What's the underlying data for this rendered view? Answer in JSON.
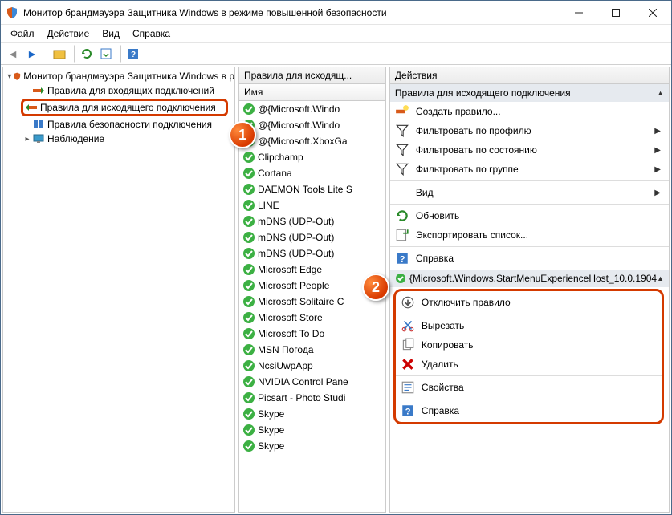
{
  "titlebar": {
    "title": "Монитор брандмауэра Защитника Windows в режиме повышенной безопасности"
  },
  "menu": {
    "file": "Файл",
    "action": "Действие",
    "view": "Вид",
    "help": "Справка"
  },
  "tree": {
    "root": "Монитор брандмауэра Защитника Windows в р",
    "inbound": "Правила для входящих подключений",
    "outbound": "Правила для исходящего подключения",
    "connsec": "Правила безопасности подключения",
    "monitoring": "Наблюдение"
  },
  "rules": {
    "panel_title": "Правила для исходящ...",
    "col_name": "Имя",
    "items": [
      "@{Microsoft.Windo",
      "@{Microsoft.Windo",
      "@{Microsoft.XboxGa",
      "Clipchamp",
      "Cortana",
      "DAEMON Tools Lite S",
      "LINE",
      "mDNS (UDP-Out)",
      "mDNS (UDP-Out)",
      "mDNS (UDP-Out)",
      "Microsoft Edge",
      "Microsoft People",
      "Microsoft Solitaire C",
      "Microsoft Store",
      "Microsoft To Do",
      "MSN Погода",
      "NcsiUwpApp",
      "NVIDIA Control Pane",
      "Picsart - Photo Studi",
      "Skype",
      "Skype",
      "Skype"
    ]
  },
  "actions": {
    "panel_title": "Действия",
    "section1_title": "Правила для исходящего подключения",
    "create_rule": "Создать правило...",
    "filter_profile": "Фильтровать по профилю",
    "filter_state": "Фильтровать по состоянию",
    "filter_group": "Фильтровать по группе",
    "view": "Вид",
    "refresh": "Обновить",
    "export": "Экспортировать список...",
    "help1": "Справка",
    "section2_title": "{Microsoft.Windows.StartMenuExperienceHost_10.0.1904",
    "disable_rule": "Отключить правило",
    "cut": "Вырезать",
    "copy": "Копировать",
    "delete": "Удалить",
    "properties": "Свойства",
    "help2": "Справка"
  },
  "callouts": {
    "one": "1",
    "two": "2"
  }
}
